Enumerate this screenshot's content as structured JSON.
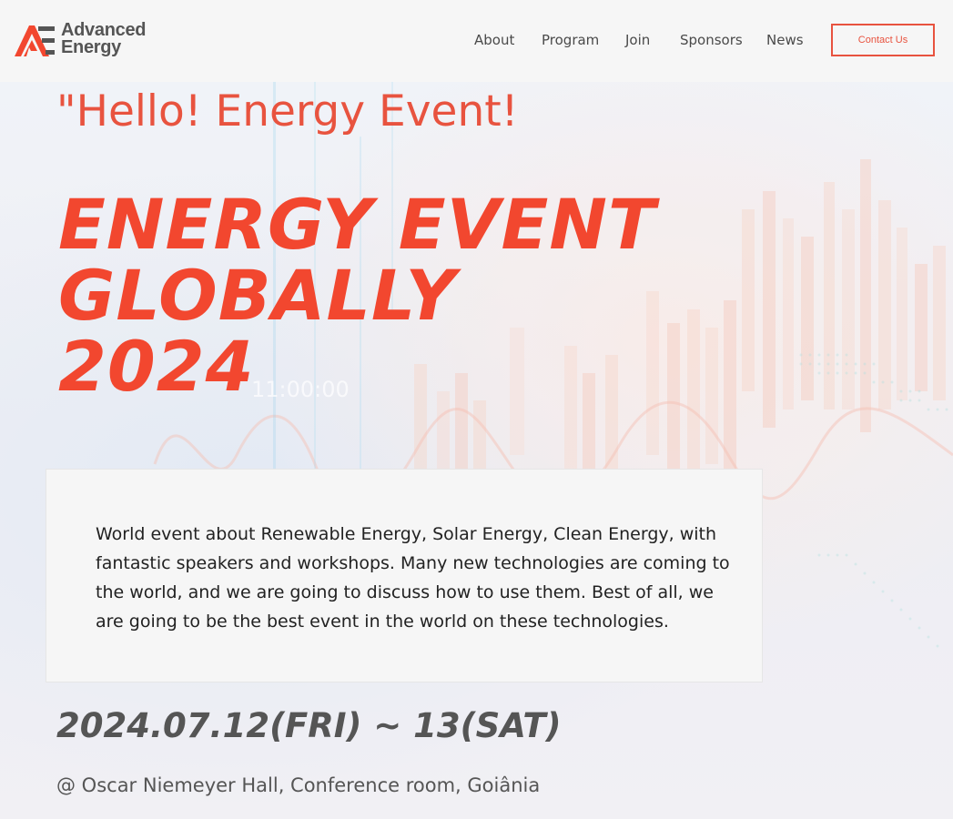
{
  "brand": {
    "line1": "Advanced",
    "line2": "Energy",
    "logo_icon": "ae-logo-icon"
  },
  "nav": {
    "items": [
      "About",
      "Program",
      "Join",
      "Sponsors",
      "News"
    ],
    "contact_label": "Contact Us"
  },
  "hero": {
    "greeting": "\"Hello! Energy Event!",
    "title_lines": [
      "ENERGY EVENT",
      "GLOBALLY",
      "2024"
    ],
    "ghost_text": "11:00:00",
    "description": "World event about Renewable Energy, Solar Energy, Clean Energy, with fantastic speakers and workshops. Many new technologies are coming to the world, and we are going to discuss how to use them. Best of all, we are going to be the best event in the world on these technologies.",
    "date": "2024.07.12(FRI) ~ 13(SAT)",
    "venue": "@ Oscar Niemeyer Hall, Conference room, Goiânia"
  },
  "colors": {
    "accent": "#e8533f",
    "title": "#f2472f",
    "text_dark": "#222222",
    "text_muted": "#555555"
  }
}
